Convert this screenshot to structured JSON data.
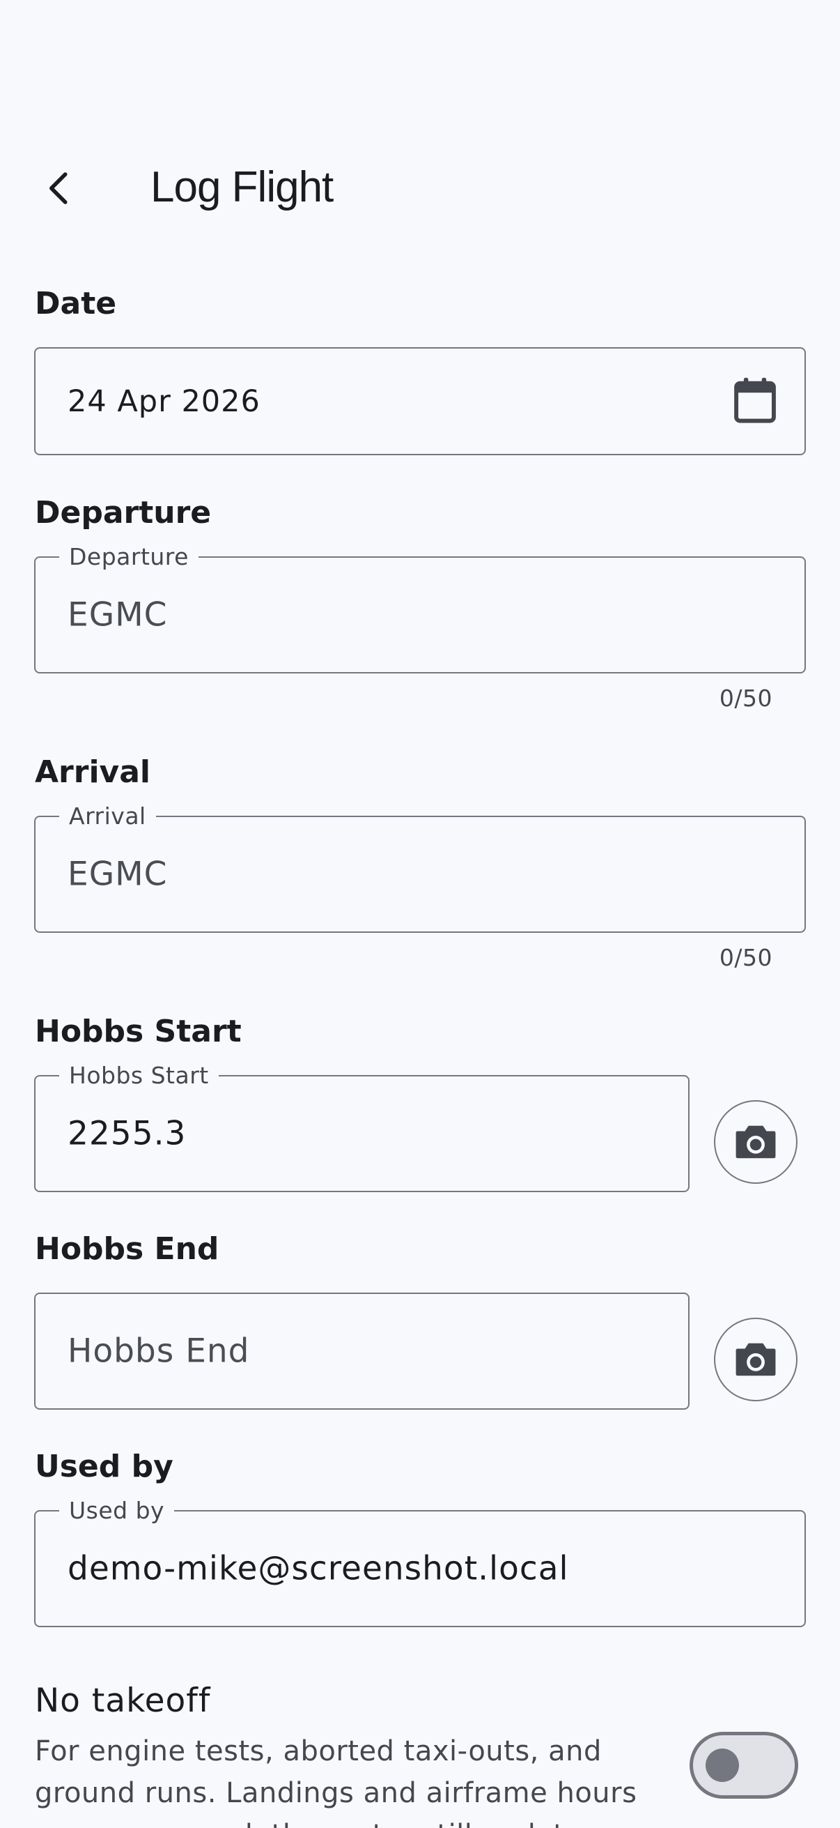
{
  "header": {
    "title": "Log Flight"
  },
  "date": {
    "label": "Date",
    "value": "24 Apr 2026"
  },
  "departure": {
    "label": "Departure",
    "field_label": "Departure",
    "value": "EGMC",
    "counter": "0/50"
  },
  "arrival": {
    "label": "Arrival",
    "field_label": "Arrival",
    "value": "EGMC",
    "counter": "0/50"
  },
  "hobbs_start": {
    "label": "Hobbs Start",
    "field_label": "Hobbs Start",
    "value": "2255.3"
  },
  "hobbs_end": {
    "label": "Hobbs End",
    "placeholder": "Hobbs End"
  },
  "used_by": {
    "label": "Used by",
    "field_label": "Used by",
    "value": "demo-mike@screenshot.local"
  },
  "no_takeoff": {
    "title": "No takeoff",
    "description": "For engine tests, aborted taxi-outs, and ground runs. Landings and airframe hours are suppressed, the meter still updates.",
    "enabled": false
  },
  "icons": {
    "back": "chevron-left-icon",
    "calendar": "calendar-icon",
    "camera": "camera-icon"
  },
  "colors": {
    "outline": "#74777f",
    "background": "#f8f9fc",
    "text": "#1b1c1f"
  }
}
